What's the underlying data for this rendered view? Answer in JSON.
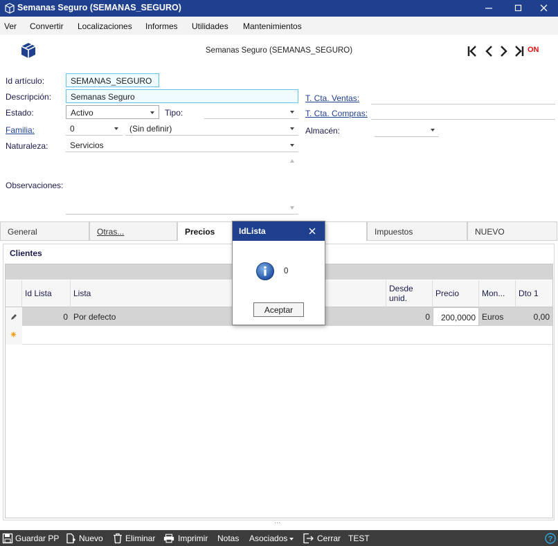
{
  "window": {
    "title": "Semanas Seguro (SEMANAS_SEGURO)"
  },
  "menu": [
    "Ver",
    "Convertir",
    "Localizaciones",
    "Informes",
    "Utilidades",
    "Mantenimientos"
  ],
  "header": {
    "title": "Semanas Seguro (SEMANAS_SEGURO)",
    "on_flag": "ON"
  },
  "form": {
    "id_articulo_label": "Id artículo:",
    "id_articulo_value": "SEMANAS_SEGURO",
    "descripcion_label": "Descripción:",
    "descripcion_value": "Semanas Seguro",
    "estado_label": "Estado:",
    "estado_value": "Activo",
    "tipo_label": "Tipo:",
    "tipo_value": "",
    "familia_label": "Familia:",
    "familia_value": "0",
    "familia_desc": "(Sin definir)",
    "naturaleza_label": "Naturaleza:",
    "naturaleza_value": "Servicios",
    "observaciones_label": "Observaciones:",
    "cta_ventas_label": "T. Cta. Ventas:",
    "cta_compras_label": "T. Cta. Compras:",
    "almacen_label": "Almacén:"
  },
  "tabs": [
    "General",
    "Otras...",
    "Precios",
    "Impuestos",
    "NUEVO"
  ],
  "subtab": "Clientes",
  "grid": {
    "columns": [
      "Id Lista",
      "Lista",
      "Desde unid.",
      "Precio",
      "Mon...",
      "Dto 1"
    ],
    "rows": [
      {
        "id_lista": "0",
        "lista": "Por defecto",
        "desde": "0",
        "precio": "200,0000",
        "moneda": "Euros",
        "dto1": "0,00"
      }
    ]
  },
  "dialog": {
    "title": "IdLista",
    "message": "0",
    "ok_label": "Aceptar"
  },
  "toolbar": [
    "Guardar PP",
    "Nuevo",
    "Eliminar",
    "Imprimir",
    "Notas",
    "Asociados",
    "Cerrar",
    "TEST"
  ],
  "colors": {
    "titlebar": "#1f3f8f",
    "accent_field": "#62c3e6",
    "toolbar": "#3c3c3c",
    "on_flag": "#e01010"
  }
}
